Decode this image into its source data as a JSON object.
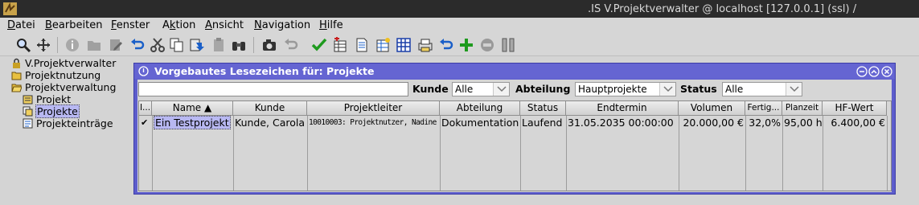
{
  "window": {
    "title": ".IS  V.Projektverwalter @ localhost [127.0.0.1] (ssl) /"
  },
  "menu": [
    {
      "mn": "D",
      "rest": "atei"
    },
    {
      "mn": "B",
      "rest": "earbeiten"
    },
    {
      "mn": "F",
      "rest": "enster"
    },
    {
      "pre": "A",
      "mn": "k",
      "rest": "tion"
    },
    {
      "mn": "A",
      "rest": "nsicht"
    },
    {
      "mn": "N",
      "rest": "avigation"
    },
    {
      "mn": "H",
      "rest": "ilfe"
    }
  ],
  "toolbar_icons": [
    "search-person-icon",
    "move-tool-icon",
    "info-icon",
    "folder-icon",
    "edit-icon",
    "undo-icon",
    "cut-icon",
    "copy-icon",
    "paste-icon",
    "clipboard-icon",
    "binoculars-icon",
    "camera-icon",
    "undo-gray-icon",
    "check-icon",
    "table-add-icon",
    "document-icon",
    "table-new-icon",
    "grid-icon",
    "print-icon",
    "undo-blue-icon",
    "add-icon",
    "stop-icon",
    "columns-icon"
  ],
  "tree": {
    "items": [
      {
        "label": "V.Projektverwalter",
        "icon": "lock-icon"
      },
      {
        "label": "Projektnutzung",
        "icon": "folder-icon"
      },
      {
        "label": "Projektverwaltung",
        "icon": "folder-open-icon"
      },
      {
        "label": "Projekt",
        "icon": "project-icon"
      },
      {
        "label": "Projekte",
        "icon": "projects-icon"
      },
      {
        "label": "Projekteinträge",
        "icon": "entries-icon"
      }
    ]
  },
  "panel": {
    "title": "Vorgebautes Lesezeichen für: Projekte",
    "search": {
      "value": "",
      "placeholder": ""
    },
    "filters": {
      "kunde_label": "Kunde",
      "kunde_value": "Alle",
      "abteilung_label": "Abteilung",
      "abteilung_value": "Hauptprojekte",
      "status_label": "Status",
      "status_value": "Alle"
    },
    "table": {
      "columns": [
        "I...",
        "Name ▲",
        "Kunde",
        "Projektleiter",
        "Abteilung",
        "Status",
        "Endtermin",
        "Volumen",
        "Fertig...",
        "Planzeit",
        "HF-Wert"
      ],
      "rows": [
        [
          "✔",
          "Ein Testprojekt",
          "Kunde, Carola",
          "10010003: Projektnutzer, Nadine",
          "Dokumentation",
          "Laufend",
          "31.05.2035 00:00:00",
          "20.000,00 €",
          "32,0%",
          "95,00 h",
          "6.400,00 €"
        ]
      ]
    }
  },
  "colors": {
    "panel_frame": "#5d5dcc",
    "selection": "#b8b8f2",
    "titlebar": "#2b2b2b"
  }
}
